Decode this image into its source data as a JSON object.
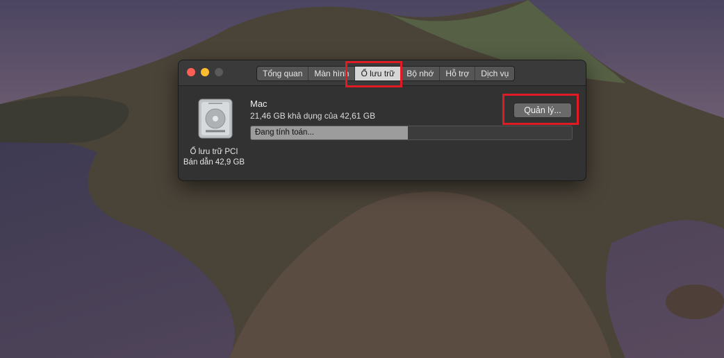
{
  "window": {
    "tabs": [
      {
        "label": "Tổng quan",
        "active": false
      },
      {
        "label": "Màn hình",
        "active": false
      },
      {
        "label": "Ổ lưu trữ",
        "active": true
      },
      {
        "label": "Bộ nhớ",
        "active": false
      },
      {
        "label": "Hỗ trợ",
        "active": false
      },
      {
        "label": "Dịch vụ",
        "active": false
      }
    ]
  },
  "storage": {
    "drive_type": "Ổ lưu trữ PCI",
    "drive_capacity": "Bán dẫn 42,9 GB",
    "volume_name": "Mac",
    "volume_info": "21,46 GB khả dụng của 42,61 GB",
    "manage_label": "Quản lý...",
    "progress_label": "Đang tính toán...",
    "progress_fraction": 0.49
  },
  "colors": {
    "highlight": "#e01b24",
    "close": "#ff5f57",
    "minimize": "#febc2e"
  }
}
